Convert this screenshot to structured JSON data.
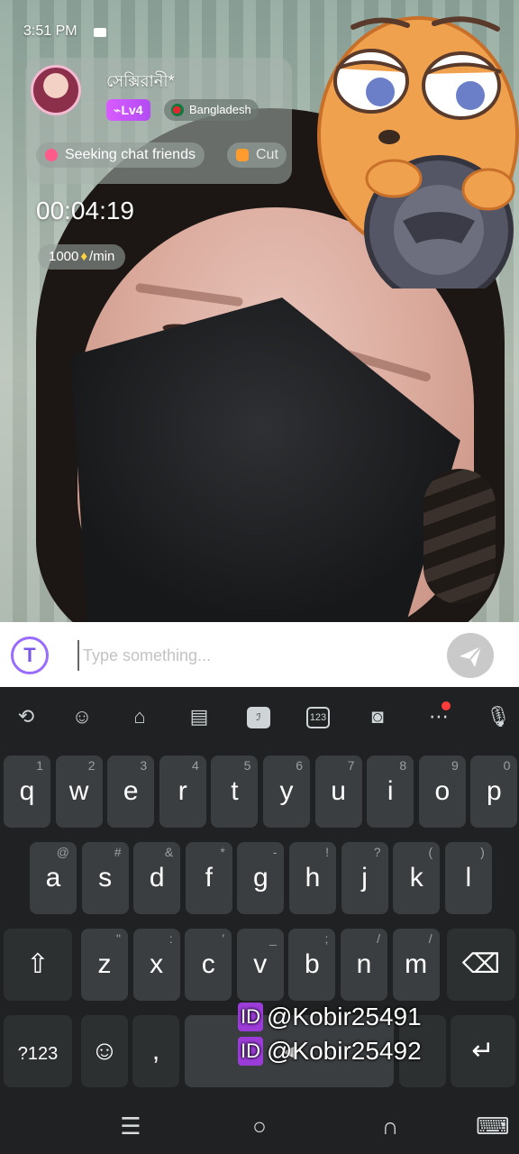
{
  "status_bar": {
    "time": "3:51 PM"
  },
  "profile": {
    "username": "সেক্সিরানী*",
    "level": "Lv4",
    "country": "Bangladesh",
    "tags": [
      "Seeking chat friends",
      "Cut"
    ]
  },
  "call": {
    "timer": "00:04:19",
    "rate_amount": "1000",
    "rate_unit": "/min"
  },
  "chat": {
    "placeholder": "Type something..."
  },
  "keyboard": {
    "toolbar_icons": [
      "translate-icon",
      "emoji-icon",
      "store-icon",
      "clipboard-icon",
      "handwriting-icon",
      "number-pad-icon",
      "screenshot-icon",
      "more-icon",
      "mic-icon"
    ],
    "toolbar_number_label": "123",
    "row1": [
      {
        "k": "q",
        "h": "1"
      },
      {
        "k": "w",
        "h": "2"
      },
      {
        "k": "e",
        "h": "3"
      },
      {
        "k": "r",
        "h": "4"
      },
      {
        "k": "t",
        "h": "5"
      },
      {
        "k": "y",
        "h": "6"
      },
      {
        "k": "u",
        "h": "7"
      },
      {
        "k": "i",
        "h": "8"
      },
      {
        "k": "o",
        "h": "9"
      },
      {
        "k": "p",
        "h": "0"
      }
    ],
    "row2": [
      {
        "k": "a",
        "h": "@"
      },
      {
        "k": "s",
        "h": "#"
      },
      {
        "k": "d",
        "h": "&"
      },
      {
        "k": "f",
        "h": "*"
      },
      {
        "k": "g",
        "h": "-"
      },
      {
        "k": "h",
        "h": "!"
      },
      {
        "k": "j",
        "h": "?"
      },
      {
        "k": "k",
        "h": "("
      },
      {
        "k": "l",
        "h": ")"
      }
    ],
    "row3": [
      {
        "k": "z",
        "h": "\""
      },
      {
        "k": "x",
        "h": ":"
      },
      {
        "k": "c",
        "h": "'"
      },
      {
        "k": "v",
        "h": "_"
      },
      {
        "k": "b",
        "h": ";"
      },
      {
        "k": "n",
        "h": "/"
      },
      {
        "k": "m",
        "h": "/"
      }
    ],
    "symbols_label": "?123",
    "comma": ","
  },
  "watermark": {
    "badge": "ID",
    "lines": [
      "@Kobir25491",
      "@Kobir25492"
    ]
  },
  "colors": {
    "level_badge": "#c255f7",
    "send_button": "#c9c9c9",
    "keyboard_bg": "#1f2122",
    "key_bg": "#3b3e40"
  }
}
